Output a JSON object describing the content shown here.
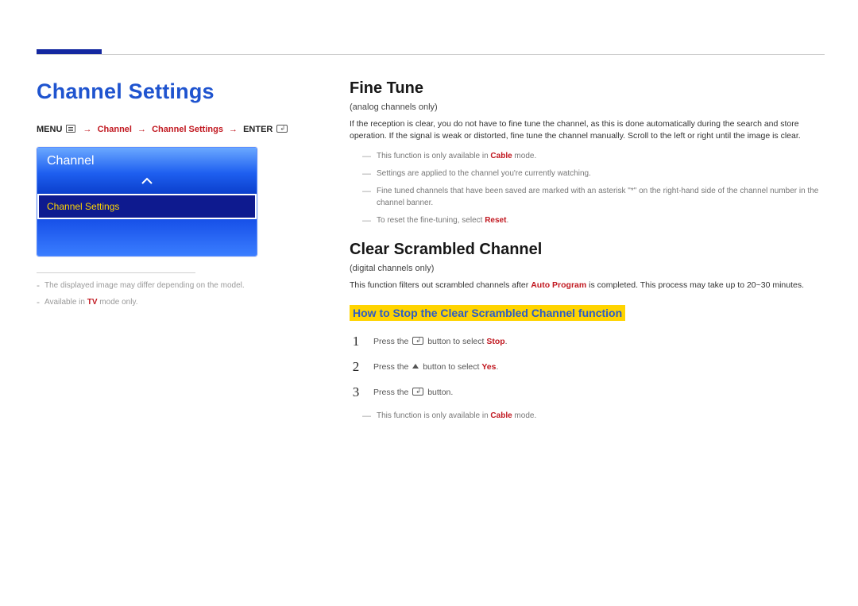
{
  "left": {
    "title": "Channel Settings",
    "breadcrumb": {
      "menu_label": "MENU",
      "seg1": "Channel",
      "seg2": "Channel Settings",
      "enter_label": "ENTER"
    },
    "osd": {
      "header": "Channel",
      "selected_item": "Channel Settings"
    },
    "footnotes": {
      "note1": "The displayed image may differ depending on the model.",
      "note2_pre": "Available in ",
      "note2_tv": "TV",
      "note2_post": " mode only."
    }
  },
  "right": {
    "fine_tune": {
      "heading": "Fine Tune",
      "subnote": "(analog channels only)",
      "body": "If the reception is clear, you do not have to fine tune the channel, as this is done automatically during the search and store operation. If the signal is weak or distorted, fine tune the channel manually. Scroll to the left or right until the image is clear.",
      "bullets": {
        "b1_pre": "This function is only available in ",
        "b1_kw": "Cable",
        "b1_post": " mode.",
        "b2": "Settings are applied to the channel you're currently watching.",
        "b3": "Fine tuned channels that have been saved are marked with an asterisk \"*\" on the right-hand side of the channel number in the channel banner.",
        "b4_pre": "To reset the fine-tuning, select ",
        "b4_kw": "Reset",
        "b4_post": "."
      }
    },
    "clear_scrambled": {
      "heading": "Clear Scrambled Channel",
      "subnote": "(digital channels only)",
      "body_pre": "This function filters out scrambled channels after ",
      "body_kw": "Auto Program",
      "body_post": " is completed. This process may take up to 20~30 minutes.",
      "howto_heading": "How to Stop the Clear Scrambled Channel function",
      "steps": {
        "s1_pre": "Press the ",
        "s1_mid": " button to select ",
        "s1_kw": "Stop",
        "s1_post": ".",
        "s2_pre": "Press the ",
        "s2_mid": " button to select ",
        "s2_kw": "Yes",
        "s2_post": ".",
        "s3_pre": "Press the ",
        "s3_post": " button."
      },
      "tail_pre": "This function is only available in ",
      "tail_kw": "Cable",
      "tail_post": " mode."
    }
  }
}
